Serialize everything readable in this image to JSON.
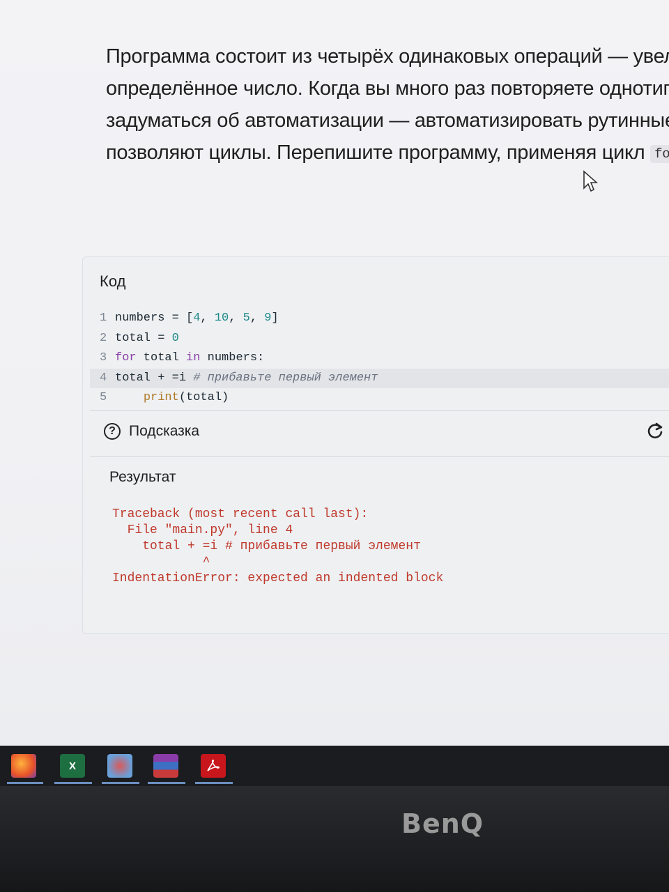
{
  "task": {
    "lines": [
      "Программа состоит из четырёх одинаковых операций — увел",
      "определённое число. Когда вы много раз повторяете однотип",
      "задуматься об автоматизации — автоматизировать рутинные",
      "позволяют циклы. Перепишите программу, применяя цикл"
    ],
    "inline_code": "fo"
  },
  "editor": {
    "title": "Код",
    "lines": [
      {
        "n": "1",
        "text": "numbers = [4, 10, 5, 9]"
      },
      {
        "n": "2",
        "text": "total = 0"
      },
      {
        "n": "3",
        "text": "for total in numbers:"
      },
      {
        "n": "4",
        "text": "total + =i # прибавьте первый элемент"
      },
      {
        "n": "5",
        "text": "    print(total)"
      }
    ]
  },
  "hint": {
    "label": "Подсказка"
  },
  "result": {
    "title": "Результат",
    "output": "Traceback (most recent call last):\n  File \"main.py\", line 4\n    total + =i # прибавьте первый элемент\n            ^\nIndentationError: expected an indented block"
  },
  "taskbar": {
    "icons": [
      "firefox-icon",
      "excel-icon",
      "paint-icon",
      "winrar-icon",
      "acrobat-icon"
    ],
    "excel_label": "X"
  },
  "monitor": {
    "brand": "BenQ"
  },
  "colors": {
    "error": "#c0392b",
    "keyword": "#8b3fa8",
    "number": "#1f8a8a"
  }
}
